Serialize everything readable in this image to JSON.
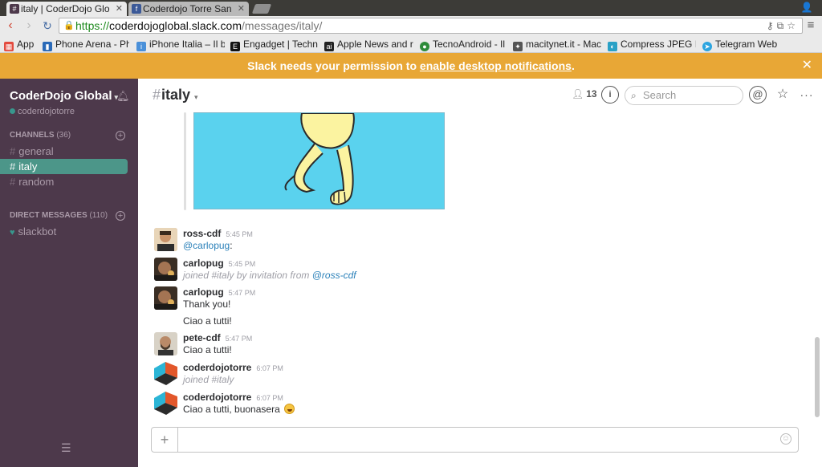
{
  "browser": {
    "tabs": [
      {
        "title": "italy | CoderDojo Glo",
        "favicon": "slack-hash-icon",
        "active": true
      },
      {
        "title": "Coderdojo Torre San",
        "favicon": "facebook-icon",
        "active": false
      }
    ],
    "url": {
      "scheme": "https://",
      "host": "coderdojoglobal.slack.com",
      "path": "/messages/italy/"
    },
    "bookmarks": [
      {
        "label": "App",
        "icon": "apps-grid-icon",
        "color": "#e34b3f"
      },
      {
        "label": "Phone Arena - Ph",
        "icon": "phonearena-icon",
        "color": "#2a6ab8"
      },
      {
        "label": "iPhone Italia – Il b",
        "icon": "iphoneitalia-icon",
        "color": "#4a90d9"
      },
      {
        "label": "Engadget | Techn",
        "icon": "engadget-icon",
        "color": "#111111"
      },
      {
        "label": "Apple News and r",
        "icon": "appleinsider-icon",
        "color": "#222222"
      },
      {
        "label": "TecnoAndroid - Il",
        "icon": "tecnoandroid-icon",
        "color": "#2e8b3a"
      },
      {
        "label": "macitynet.it - Mac",
        "icon": "macitynet-icon",
        "color": "#555555"
      },
      {
        "label": "Compress JPEG Ir",
        "icon": "compressjpeg-icon",
        "color": "#2aa1c6"
      },
      {
        "label": "Telegram Web",
        "icon": "telegram-icon",
        "color": "#2ca5e0"
      }
    ]
  },
  "banner": {
    "text": "Slack needs your permission to ",
    "link": "enable desktop notifications",
    "suffix": ".",
    "color": "#e8a736"
  },
  "sidebar": {
    "team": "CoderDojo Global",
    "user": "coderdojotorre",
    "channels_label": "CHANNELS",
    "channels_count": "(36)",
    "channels": [
      {
        "name": "general",
        "active": false
      },
      {
        "name": "italy",
        "active": true
      },
      {
        "name": "random",
        "active": false
      }
    ],
    "dm_label": "DIRECT MESSAGES",
    "dm_count": "(110)",
    "dms": [
      {
        "name": "slackbot"
      }
    ],
    "bg_color": "#4d394b",
    "active_color": "#4c9689"
  },
  "header": {
    "channel": "italy",
    "members": "13",
    "search_placeholder": "Search"
  },
  "messages": [
    {
      "user": "ross-cdf",
      "time": "5:45 PM",
      "lines": [
        {
          "kind": "mention",
          "text": "@carlopug",
          "after": ":"
        }
      ]
    },
    {
      "user": "carlopug",
      "time": "5:45 PM",
      "lines": [
        {
          "kind": "system",
          "text": "joined #italy by invitation from ",
          "mention": "@ross-cdf"
        }
      ]
    },
    {
      "user": "carlopug",
      "time": "5:47 PM",
      "lines": [
        {
          "kind": "text",
          "text": "Thank you!"
        },
        {
          "kind": "text",
          "text": "Ciao a tutti!"
        }
      ]
    },
    {
      "user": "pete-cdf",
      "time": "5:47 PM",
      "lines": [
        {
          "kind": "text",
          "text": "Ciao a tutti!"
        }
      ]
    },
    {
      "user": "coderdojotorre",
      "time": "6:07 PM",
      "lines": [
        {
          "kind": "system",
          "text": "joined #italy"
        }
      ]
    },
    {
      "user": "coderdojotorre",
      "time": "6:07 PM",
      "lines": [
        {
          "kind": "text",
          "text": "Ciao a tutti, buonasera",
          "emoji": "grinning-face-icon"
        }
      ]
    }
  ],
  "composer": {
    "value": ""
  }
}
